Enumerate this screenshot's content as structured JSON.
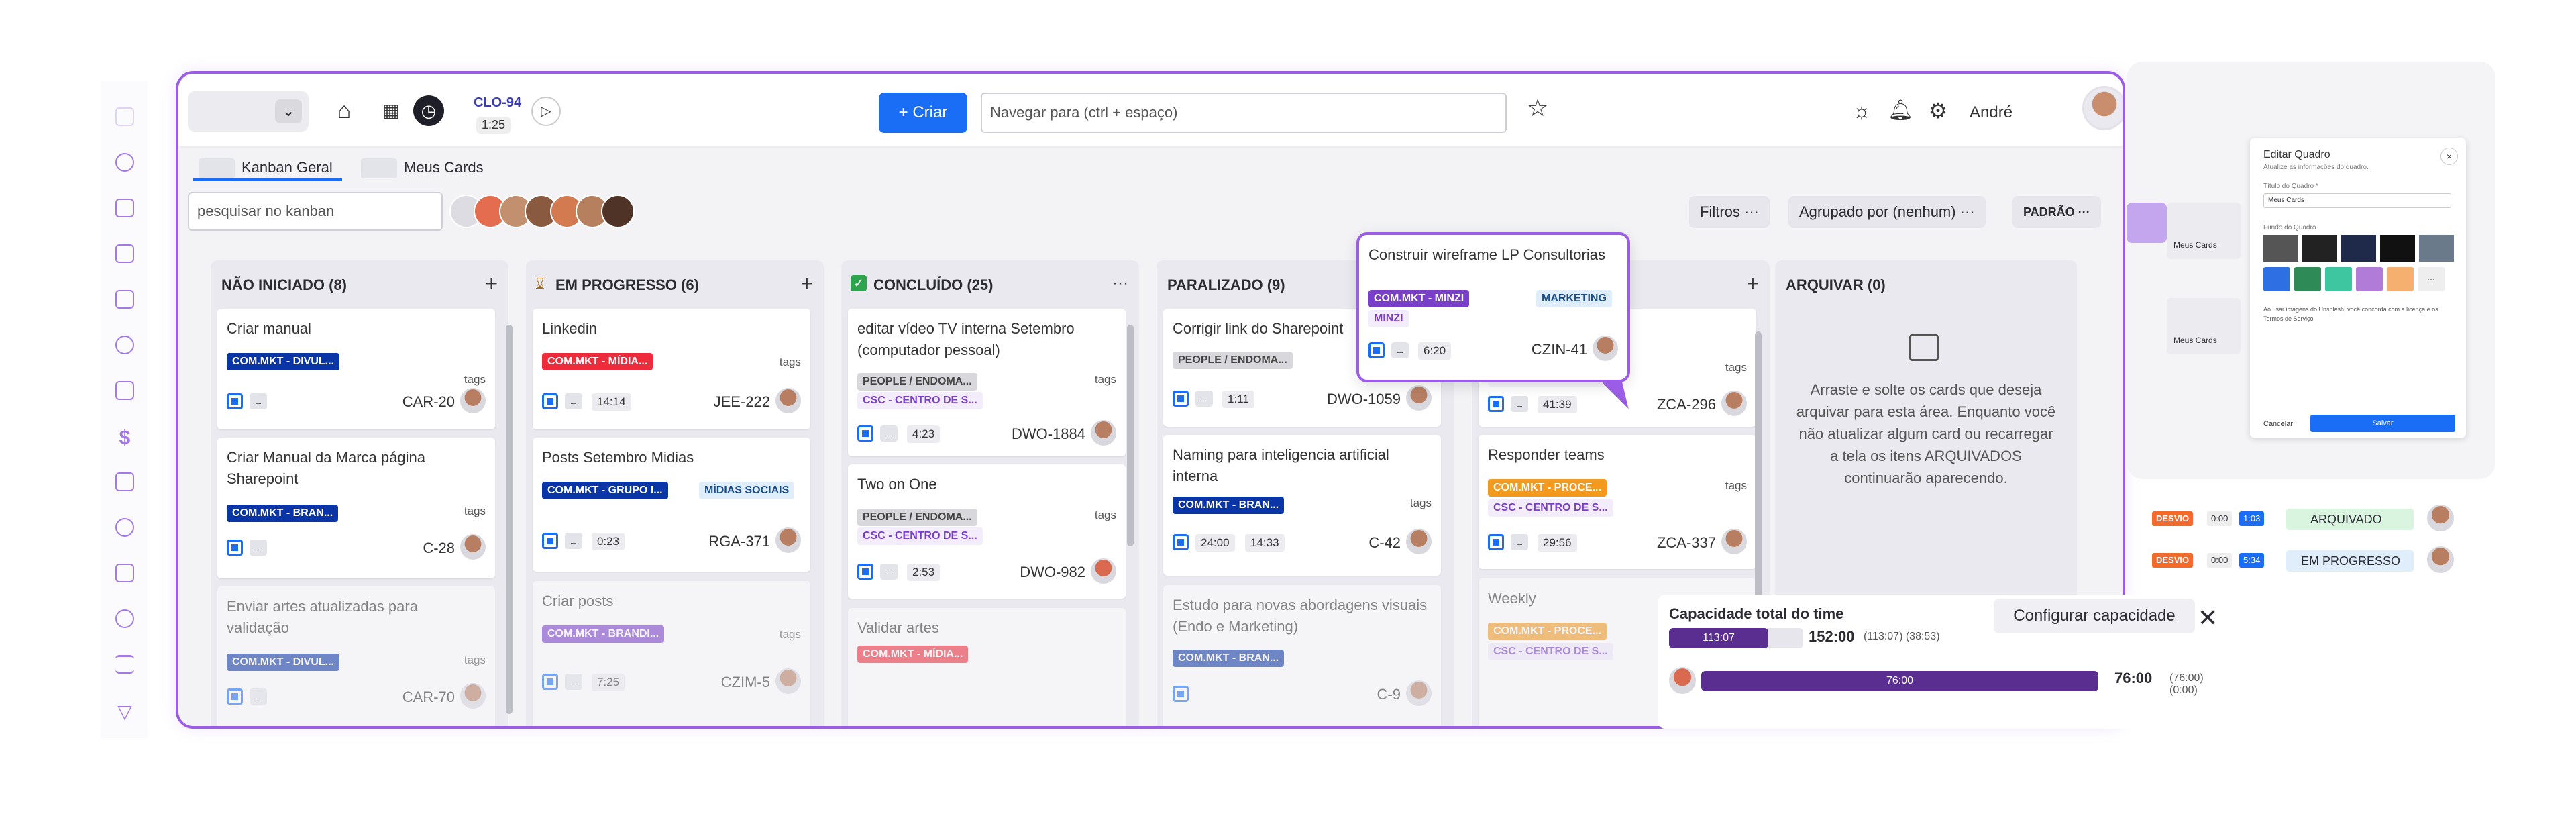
{
  "header": {
    "timer_code": "CLO-94",
    "timer_time": "1:25",
    "create_label": "+ Criar",
    "nav_placeholder": "Navegar para (ctrl + espaço)",
    "user_name": "André"
  },
  "tabs": [
    "Kanban Geral",
    "Meus Cards"
  ],
  "filters": {
    "search_placeholder": "pesquisar no kanban",
    "filtros": "Filtros ···",
    "agrupado": "Agrupado por (nenhum) ···",
    "padrao": "PADRÃO ···"
  },
  "columns": [
    {
      "title": "NÃO INICIADO (8)",
      "cards": [
        {
          "title": "Criar manual",
          "tag": "COM.MKT - DIVUL...",
          "tags_label": "tags",
          "id": "CAR-20"
        },
        {
          "title": "Criar Manual da Marca página Sharepoint",
          "tag": "COM.MKT - BRAN...",
          "tags_label": "tags",
          "id": "C-28"
        },
        {
          "title": "Enviar artes atualizadas para validação",
          "tag": "COM.MKT - DIVUL...",
          "tags_label": "tags",
          "id": "CAR-70"
        }
      ]
    },
    {
      "title": "EM PROGRESSO (6)",
      "cards": [
        {
          "title": "Linkedin",
          "tag": "COM.MKT - MÍDIA...",
          "tags_label": "tags",
          "time": "14:14",
          "id": "JEE-222"
        },
        {
          "title": "Posts Setembro Midias",
          "tag": "COM.MKT - GRUPO I...",
          "tag2": "MÍDIAS SOCIAIS",
          "time": "0:23",
          "id": "RGA-371"
        },
        {
          "title": "Criar posts",
          "tag": "COM.MKT - BRANDI...",
          "tags_label": "tags",
          "time": "7:25",
          "id": "CZIM-5"
        }
      ]
    },
    {
      "title": "CONCLUÍDO (25)",
      "cards": [
        {
          "title": "editar vídeo TV interna Setembro (computador pessoal)",
          "tag": "PEOPLE / ENDOMA...",
          "tag2": "CSC - CENTRO DE S...",
          "tags_label": "tags",
          "time": "4:23",
          "id": "DWO-1884"
        },
        {
          "title": "Two on One",
          "tag": "PEOPLE / ENDOMA...",
          "tag2": "CSC - CENTRO DE S...",
          "tags_label": "tags",
          "time": "2:53",
          "id": "DWO-982"
        },
        {
          "title": "Validar artes",
          "tag": "COM.MKT - MÍDIA..."
        }
      ]
    },
    {
      "title": "PARALIZADO (9)",
      "cards": [
        {
          "title": "Corrigir link do Sharepoint",
          "tag": "PEOPLE / ENDOMA...",
          "time": "1:11",
          "id": "DWO-1059"
        },
        {
          "title": "Naming para inteligencia artificial interna",
          "tag": "COM.MKT - BRAN...",
          "tags_label": "tags",
          "time": "24:00",
          "time2": "14:33",
          "id": "C-42"
        },
        {
          "title": "Estudo para novas abordagens visuais (Endo e Marketing)",
          "tag": "COM.MKT - BRAN...",
          "id": "C-9"
        }
      ]
    },
    {
      "title": "",
      "cards": [
        {
          "title": "",
          "tag": "CSC - CENTRO DE S...",
          "tags_label": "tags",
          "time": "41:39",
          "id": "ZCA-296"
        },
        {
          "title": "Responder teams",
          "tag": "COM.MKT - PROCE...",
          "tag2": "CSC - CENTRO DE S...",
          "tags_label": "tags",
          "time": "29:56",
          "id": "ZCA-337"
        },
        {
          "title": "Weekly",
          "tag": "COM.MKT - PROCE...",
          "tag2": "CSC - CENTRO DE S..."
        }
      ]
    },
    {
      "title": "ARQUIVAR (0)",
      "empty": "Arraste e solte os cards que deseja arquivar para esta área. Enquanto você não atualizar algum card ou recarregar a tela os itens ARQUIVADOS continuarão aparecendo."
    }
  ],
  "popup": {
    "title": "Construir wireframe LP Consultorias",
    "tag1": "COM.MKT - MINZI",
    "tag2": "MARKETING",
    "tag3": "MINZI",
    "time": "6:20",
    "id": "CZIN-41"
  },
  "capacity": {
    "title": "Capacidade total do time",
    "configure": "Configurar capacidade",
    "top_bar_label": "113:07",
    "top_value": "152:00",
    "top_detail": "(113:07) (38:53)",
    "bottom_bar_label": "76:00",
    "bottom_value": "76:00",
    "bottom_detail": "(76:00) (0:00)",
    "top_fraction": 0.74,
    "bottom_fraction": 1.0
  },
  "right_panel": {
    "dialog": {
      "title": "Editar Quadro",
      "subtitle": "Atualize as informações do quadro.",
      "field_label": "Título do Quadro *",
      "field_value": "Meus Cards",
      "bg_label": "Fundo do Quadro",
      "terms": "Ao usar imagens do Unsplash, você concorda com a licença e os Termos de Serviço",
      "cancel": "Cancelar",
      "save": "Salvar"
    },
    "mini_cards": [
      "Meus Cards",
      "Meus Cards"
    ],
    "rows": [
      {
        "badge": "DESVIO",
        "t1": "0:00",
        "t2": "1:03",
        "status": "ARQUIVADO"
      },
      {
        "badge": "DESVIO",
        "t1": "0:00",
        "t2": "5:34",
        "status": "EM PROGRESSO"
      }
    ]
  },
  "colors": {
    "accent": "#9b5de5",
    "primary": "#1a6ef5",
    "dark_blue": "#0a35a6",
    "red": "#ee2b3b",
    "purple": "#7a3fc8",
    "orange": "#f39a1e",
    "green_check": "#2ea44f"
  }
}
